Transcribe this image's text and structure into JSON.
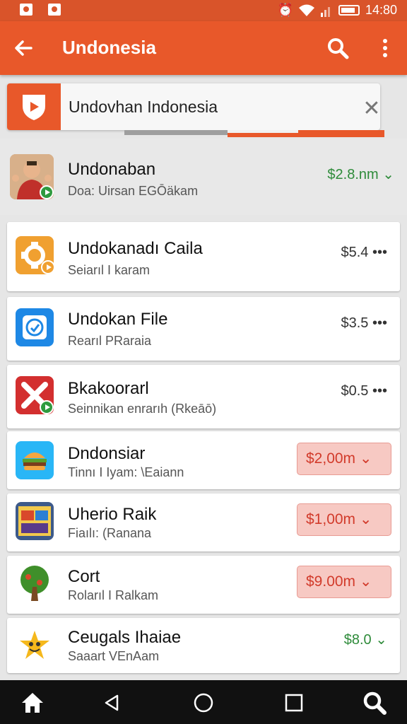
{
  "status_bar": {
    "time": "14:80"
  },
  "app_bar": {
    "title": "Undonesia",
    "back_icon": "arrow-left-icon",
    "search_icon": "search-icon",
    "more_icon": "more-vert-icon"
  },
  "search": {
    "value": "Undovhan Indonesia",
    "clear_label": "✕"
  },
  "results": [
    {
      "title": "Undonaban",
      "subtitle": "Doa: Uirsan EGŌäkam",
      "price": "$2.8.nm",
      "price_style": "green",
      "icon": "person-avatar-icon",
      "marker": "⌄"
    },
    {
      "title": "Undokanadı Caila",
      "subtitle": "Seiarıl I karam",
      "price": "$5.4",
      "price_style": "plain",
      "icon": "orange-gear-icon",
      "marker": "•••"
    },
    {
      "title": "Undokan File",
      "subtitle": "Rearıl PRaraia",
      "price": "$3.5",
      "price_style": "plain",
      "icon": "blue-cloud-icon",
      "marker": "•••"
    },
    {
      "title": "Bkakoorarl",
      "subtitle": "Seinnikan enrarıh (Rkeāō)",
      "price": "$0.5",
      "price_style": "plain",
      "icon": "red-x-icon",
      "marker": "•••"
    },
    {
      "title": "Dndonsiar",
      "subtitle": "Tinnı I Iyam: \\Eaiann",
      "price": "$2,00m",
      "price_style": "pill",
      "icon": "burger-icon",
      "marker": "⌄"
    },
    {
      "title": "Uherio Raik",
      "subtitle": "Fiaılı: (Ranana",
      "price": "$1,00m",
      "price_style": "pill",
      "icon": "comic-icon",
      "marker": "⌄"
    },
    {
      "title": "Cort",
      "subtitle": "Rolarıl I Ralkam",
      "price": "$9.00m",
      "price_style": "pill",
      "icon": "tree-icon",
      "marker": "⌄"
    },
    {
      "title": "Ceugals Ihaiae",
      "subtitle": "Saaart VEnAam",
      "price": "$8.0",
      "price_style": "green",
      "icon": "smiley-star-icon",
      "marker": "⌄"
    }
  ],
  "nav": [
    "home-icon",
    "back-triangle-icon",
    "home-circle-icon",
    "recents-square-icon",
    "search-icon"
  ],
  "colors": {
    "accent": "#e8582a",
    "green": "#2e8b3a",
    "pill_bg": "#f7c9c3",
    "pill_text": "#d23b2b"
  }
}
